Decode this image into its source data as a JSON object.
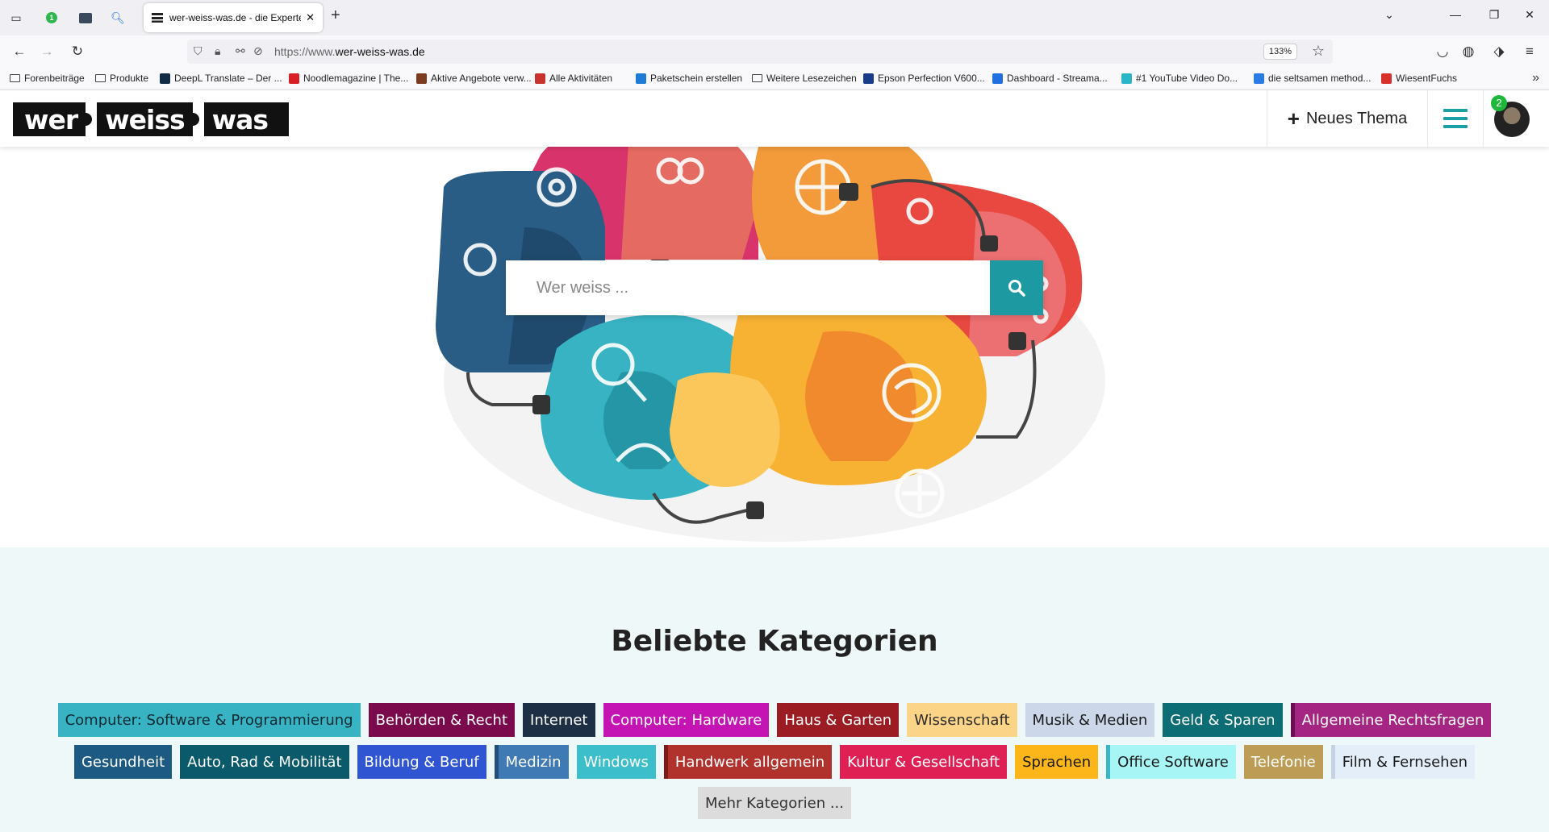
{
  "browser": {
    "active_tab_title": "wer-weiss-was.de - die Experten",
    "pinned_badge": "1",
    "url_prefix": "https://www.",
    "url_domain": "wer-weiss-was.de",
    "zoom": "133%",
    "bookmarks": [
      {
        "label": "Forenbeiträge",
        "icon": "folder",
        "color": ""
      },
      {
        "label": "Produkte",
        "icon": "folder",
        "color": ""
      },
      {
        "label": "DeepL Translate – Der ...",
        "icon": "deepl",
        "color": "#0f2b46"
      },
      {
        "label": "Noodlemagazine | The...",
        "icon": "play",
        "color": "#d81f26"
      },
      {
        "label": "Aktive Angebote verw...",
        "icon": "shop",
        "color": "#7a3b1e"
      },
      {
        "label": "Alle Aktivitäten",
        "icon": "bars",
        "color": "#c8322f"
      },
      {
        "label": "Paketschein erstellen",
        "icon": "package",
        "color": "#1e7bd6"
      },
      {
        "label": "Weitere Lesezeichen",
        "icon": "folder",
        "color": ""
      },
      {
        "label": "Epson Perfection V600...",
        "icon": "epson",
        "color": "#1a3a8a"
      },
      {
        "label": "Dashboard - Streama...",
        "icon": "circle",
        "color": "#1f6fe0"
      },
      {
        "label": "#1 YouTube Video Do...",
        "icon": "yt",
        "color": "#2bb6c8"
      },
      {
        "label": "die seltsamen method...",
        "icon": "bing",
        "color": "#2a7be4"
      },
      {
        "label": "WiesentFuchs",
        "icon": "fox",
        "color": "#d8312c"
      }
    ]
  },
  "header": {
    "logo_parts": [
      "wer",
      "weiss",
      "was"
    ],
    "new_topic_label": "Neues Thema",
    "notification_count": "2"
  },
  "search": {
    "placeholder": "Wer weiss ..."
  },
  "categories": {
    "title": "Beliebte Kategorien",
    "rows": [
      [
        {
          "label": "Computer: Software & Programmierung",
          "bg": "#37b3c3",
          "fg": "#0d2a30"
        },
        {
          "label": "Behörden & Recht",
          "bg": "#7a0a4c",
          "fg": "#ffffff"
        },
        {
          "label": "Internet",
          "bg": "#1c2f44",
          "fg": "#ffffff"
        },
        {
          "label": "Computer: Hardware",
          "bg": "#c414b4",
          "fg": "#ffffff"
        },
        {
          "label": "Haus & Garten",
          "bg": "#9c1c23",
          "fg": "#ffffff"
        },
        {
          "label": "Wissenschaft",
          "bg": "#fcd488",
          "fg": "#2a2a2a"
        },
        {
          "label": "Musik & Medien",
          "bg": "#cdd7ea",
          "fg": "#1a1a1a"
        },
        {
          "label": "Geld & Sparen",
          "bg": "#0c6d75",
          "fg": "#ffffff"
        },
        {
          "label": "Allgemeine Rechtsfragen",
          "bg": "#a52582",
          "fg": "#ffffff",
          "border": "#6a0f50"
        }
      ],
      [
        {
          "label": "Gesundheit",
          "bg": "#1c5a84",
          "fg": "#ffffff"
        },
        {
          "label": "Auto, Rad & Mobilität",
          "bg": "#0b5a6c",
          "fg": "#ffffff"
        },
        {
          "label": "Bildung & Beruf",
          "bg": "#2f55d3",
          "fg": "#ffffff"
        },
        {
          "label": "Medizin",
          "bg": "#3f7ab4",
          "fg": "#ffffff",
          "border": "#234e7c"
        },
        {
          "label": "Windows",
          "bg": "#3cbecb",
          "fg": "#ffffff"
        },
        {
          "label": "Handwerk allgemein",
          "bg": "#b1322d",
          "fg": "#ffffff",
          "border": "#7e1a16"
        },
        {
          "label": "Kultur & Gesellschaft",
          "bg": "#df2054",
          "fg": "#ffffff"
        },
        {
          "label": "Sprachen",
          "bg": "#fcb61a",
          "fg": "#1a1a1a"
        },
        {
          "label": "Office Software",
          "bg": "#a7f5f5",
          "fg": "#1a1a1a",
          "border": "#39b6c3"
        },
        {
          "label": "Telefonie",
          "bg": "#bd9d55",
          "fg": "#ffffff"
        },
        {
          "label": "Film & Fernsehen",
          "bg": "#e3eef9",
          "fg": "#1a1a1a",
          "border": "#c4d2e4"
        }
      ]
    ],
    "more_label": "Mehr Kategorien ..."
  },
  "colors": {
    "accent": "#1d9aa1",
    "category_bg": "#eef8f8"
  }
}
